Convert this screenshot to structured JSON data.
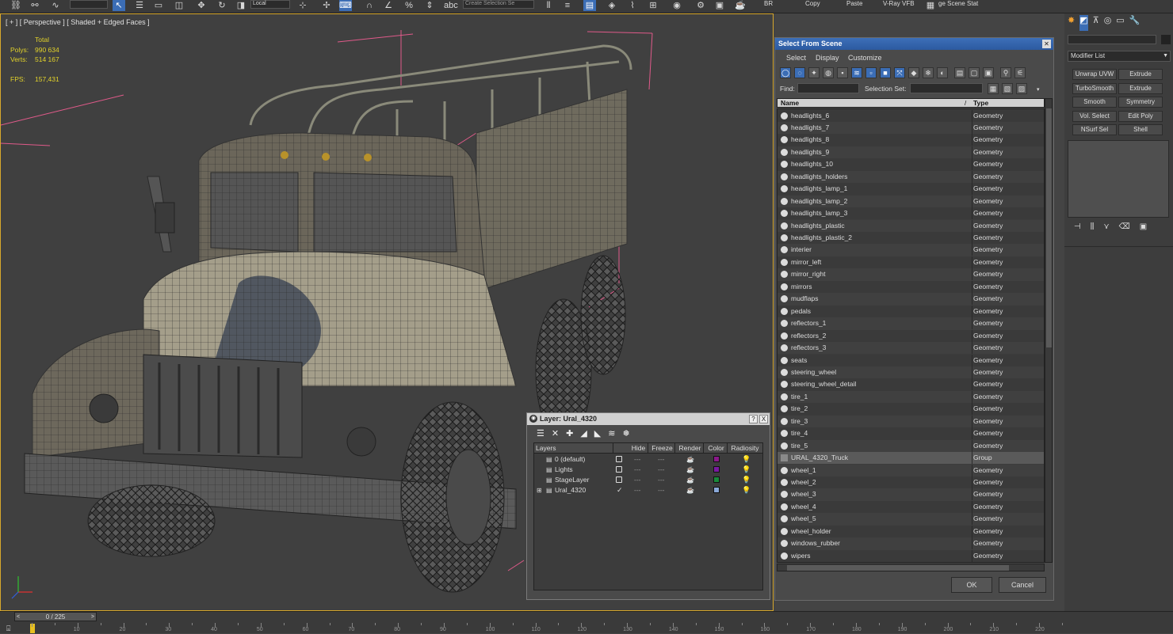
{
  "toolbar": {
    "coord_system": "Local",
    "selection_set_placeholder": "Create Selection Se",
    "labels": [
      "BR",
      "Copy",
      "Paste",
      "V-Ray VFB",
      "ge Scene Stat"
    ]
  },
  "viewport": {
    "label": "[ + ] [ Perspective ] [ Shaded + Edged Faces ]",
    "stats": {
      "total_label": "Total",
      "polys_label": "Polys:",
      "polys_value": "990 634",
      "verts_label": "Verts:",
      "verts_value": "514 167",
      "fps_label": "FPS:",
      "fps_value": "157,431"
    }
  },
  "command_panel": {
    "modifier_list": "Modifier List",
    "buttons": [
      "Unwrap UVW",
      "Extrude",
      "TurboSmooth",
      "Extrude",
      "Smooth",
      "Symmetry",
      "Vol. Select",
      "Edit Poly",
      "NSurf Sel",
      "Shell"
    ]
  },
  "select_from_scene": {
    "title": "Select From Scene",
    "menus": [
      "Select",
      "Display",
      "Customize"
    ],
    "find_label": "Find:",
    "selection_set_label": "Selection Set:",
    "columns": {
      "name": "Name",
      "sort": "/",
      "type": "Type"
    },
    "rows": [
      {
        "name": "headlights_6",
        "type": "Geometry"
      },
      {
        "name": "headlights_7",
        "type": "Geometry"
      },
      {
        "name": "headlights_8",
        "type": "Geometry"
      },
      {
        "name": "headlights_9",
        "type": "Geometry"
      },
      {
        "name": "headlights_10",
        "type": "Geometry"
      },
      {
        "name": "headlights_holders",
        "type": "Geometry"
      },
      {
        "name": "headlights_lamp_1",
        "type": "Geometry"
      },
      {
        "name": "headlights_lamp_2",
        "type": "Geometry"
      },
      {
        "name": "headlights_lamp_3",
        "type": "Geometry"
      },
      {
        "name": "headlights_plastic",
        "type": "Geometry"
      },
      {
        "name": "headlights_plastic_2",
        "type": "Geometry"
      },
      {
        "name": "interier",
        "type": "Geometry"
      },
      {
        "name": "mirror_left",
        "type": "Geometry"
      },
      {
        "name": "mirror_right",
        "type": "Geometry"
      },
      {
        "name": "mirrors",
        "type": "Geometry"
      },
      {
        "name": "mudflaps",
        "type": "Geometry"
      },
      {
        "name": "pedals",
        "type": "Geometry"
      },
      {
        "name": "reflectors_1",
        "type": "Geometry"
      },
      {
        "name": "reflectors_2",
        "type": "Geometry"
      },
      {
        "name": "reflectors_3",
        "type": "Geometry"
      },
      {
        "name": "seats",
        "type": "Geometry"
      },
      {
        "name": "steering_wheel",
        "type": "Geometry"
      },
      {
        "name": "steering_wheel_detail",
        "type": "Geometry"
      },
      {
        "name": "tire_1",
        "type": "Geometry"
      },
      {
        "name": "tire_2",
        "type": "Geometry"
      },
      {
        "name": "tire_3",
        "type": "Geometry"
      },
      {
        "name": "tire_4",
        "type": "Geometry"
      },
      {
        "name": "tire_5",
        "type": "Geometry"
      },
      {
        "name": "URAL_4320_Truck",
        "type": "Group"
      },
      {
        "name": "wheel_1",
        "type": "Geometry"
      },
      {
        "name": "wheel_2",
        "type": "Geometry"
      },
      {
        "name": "wheel_3",
        "type": "Geometry"
      },
      {
        "name": "wheel_4",
        "type": "Geometry"
      },
      {
        "name": "wheel_5",
        "type": "Geometry"
      },
      {
        "name": "wheel_holder",
        "type": "Geometry"
      },
      {
        "name": "windows_rubber",
        "type": "Geometry"
      },
      {
        "name": "wipers",
        "type": "Geometry"
      }
    ],
    "ok": "OK",
    "cancel": "Cancel"
  },
  "layer_dialog": {
    "title": "Layer: Ural_4320",
    "help": "?",
    "close": "X",
    "columns": [
      "Layers",
      "Hide",
      "Freeze",
      "Render",
      "Color",
      "Radiosity"
    ],
    "rows": [
      {
        "name": "0 (default)",
        "color": "#8a1a8a"
      },
      {
        "name": "Lights",
        "color": "#7a1aa0"
      },
      {
        "name": "StageLayer",
        "color": "#1a8a3a"
      },
      {
        "name": "Ural_4320",
        "color": "#8aa8d8"
      }
    ]
  },
  "timeline": {
    "frame": "0 / 225",
    "ticks": [
      "10",
      "20",
      "30",
      "40",
      "50",
      "60",
      "70",
      "80",
      "90",
      "100",
      "110",
      "120",
      "130",
      "140",
      "150",
      "160",
      "170",
      "180",
      "190",
      "200",
      "210",
      "220"
    ]
  }
}
